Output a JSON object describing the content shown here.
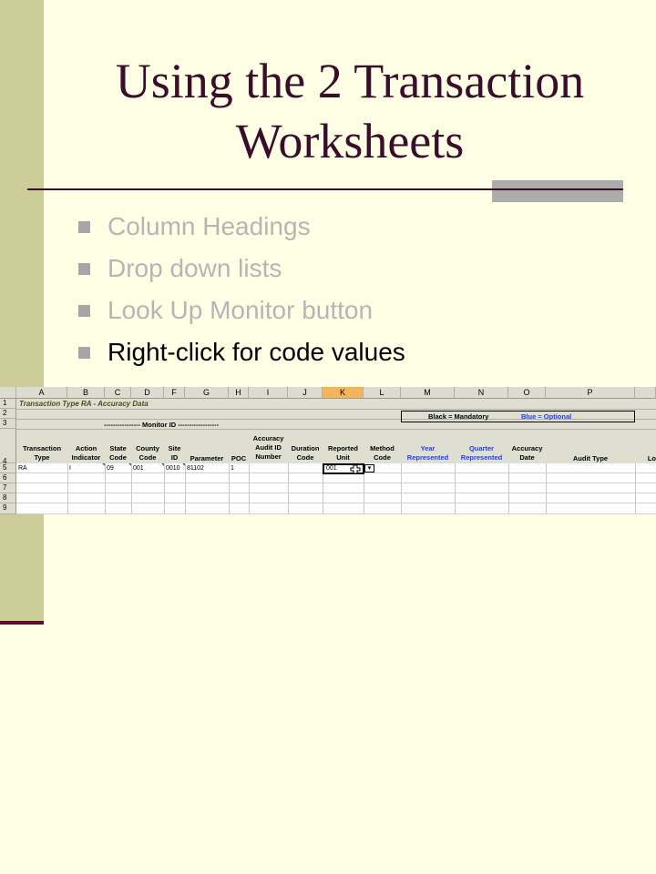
{
  "slide": {
    "title_line1": "Using the 2 Transaction",
    "title_line2": "Worksheets",
    "bullets": [
      {
        "label": "Column Headings",
        "state": "dim"
      },
      {
        "label": "Drop down lists",
        "state": "dim"
      },
      {
        "label": "Look Up Monitor button",
        "state": "dim"
      },
      {
        "label": "Right-click for code values",
        "state": "active"
      }
    ]
  },
  "sheet": {
    "columns": [
      "A",
      "B",
      "C",
      "D",
      "F",
      "G",
      "H",
      "I",
      "J",
      "K",
      "L",
      "M",
      "N",
      "O",
      "P"
    ],
    "selected_column": "K",
    "row_numbers": [
      "1",
      "2",
      "3",
      "4",
      "5",
      "6",
      "7",
      "8",
      "9"
    ],
    "title": "Transaction Type RA  -  Accuracy Data",
    "monitor_id": "----------------  Monitor ID  ------------------",
    "legend_black": "Black = Mandatory",
    "legend_blue": "Blue = Optional",
    "headers": {
      "A": [
        "Transaction",
        "Type"
      ],
      "B": [
        "Action",
        "Indicator"
      ],
      "C": [
        "State",
        "Code"
      ],
      "D": [
        "County",
        "Code"
      ],
      "F": [
        "Site",
        "ID"
      ],
      "G": [
        "Parameter"
      ],
      "H": [
        "POC"
      ],
      "I": [
        "Accuracy",
        "Audit ID",
        "Number"
      ],
      "J": [
        "Duration",
        "Code"
      ],
      "K": [
        "Reported",
        "Unit"
      ],
      "L": [
        "Method",
        "Code"
      ],
      "M": [
        "Year",
        "Represented"
      ],
      "N": [
        "Quarter",
        "Represented"
      ],
      "O": [
        "Accuracy",
        "Date"
      ],
      "P": [
        "Audit Type"
      ],
      "Q": [
        "Lo"
      ]
    },
    "row5": {
      "A": "RA",
      "B": "I",
      "C": "09",
      "D": "001",
      "F": "0010",
      "G": "81102",
      "H": "1",
      "K": "001"
    },
    "colors": {
      "optional_blue": "#1f3cff",
      "selected_header": "#f5b35a"
    }
  }
}
